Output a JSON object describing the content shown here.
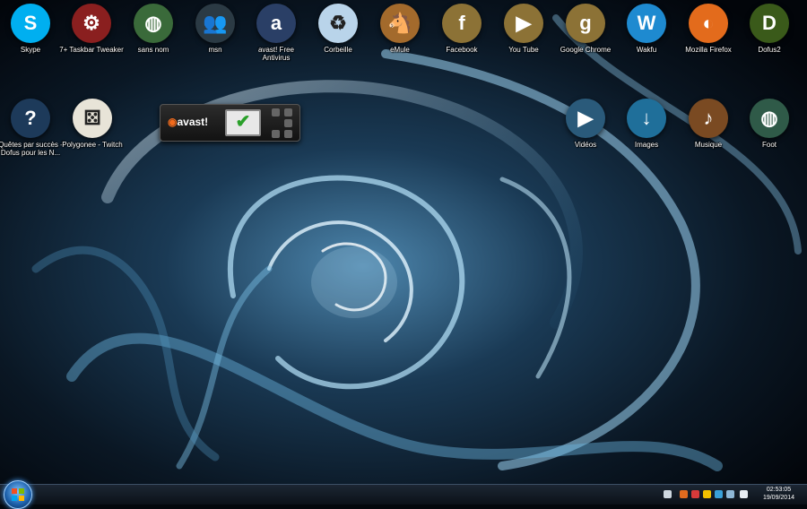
{
  "desktop": {
    "icons": [
      {
        "label": "Skype",
        "icon": "skype-icon",
        "color": "#00aff0"
      },
      {
        "label": "7+ Taskbar Tweaker",
        "icon": "gear-icon",
        "color": "#8a1f1f"
      },
      {
        "label": "sans nom",
        "icon": "globe-icon",
        "color": "#3a6a3a"
      },
      {
        "label": "msn",
        "icon": "people-icon",
        "color": "#2b3a44"
      },
      {
        "label": "avast! Free Antivirus",
        "icon": "avast-icon",
        "color": "#2a3f66"
      },
      {
        "label": "Corbeille",
        "icon": "recycle-bin-icon",
        "color": "#b9d4ea"
      },
      {
        "label": "eMule",
        "icon": "mule-icon",
        "color": "#a36a2c"
      },
      {
        "label": "Facebook",
        "icon": "facebook-shield-icon",
        "color": "#8c7236"
      },
      {
        "label": "You Tube",
        "icon": "youtube-shield-icon",
        "color": "#8c7236"
      },
      {
        "label": "Google Chrome",
        "icon": "google-shield-icon",
        "color": "#8c7236"
      },
      {
        "label": "Wakfu",
        "icon": "wakfu-icon",
        "color": "#1e8ad0"
      },
      {
        "label": "Mozilla Firefox",
        "icon": "firefox-icon",
        "color": "#e36b1c"
      },
      {
        "label": "Dofus2",
        "icon": "dofus-icon",
        "color": "#3a5a1a"
      },
      {
        "label": "Quêtes par succès - Dofus pour les N...",
        "icon": "help-sign-icon",
        "color": "#1d3a5a"
      },
      {
        "label": "Polygonee - Twitch",
        "icon": "dice-icon",
        "color": "#e8e4d8"
      },
      {
        "label": "Vidéos",
        "icon": "videos-folder-icon",
        "color": "#2a5a7a"
      },
      {
        "label": "Images",
        "icon": "images-folder-icon",
        "color": "#1f6f9a"
      },
      {
        "label": "Musique",
        "icon": "music-folder-icon",
        "color": "#7a4a22"
      },
      {
        "label": "Foot",
        "icon": "globe-icon",
        "color": "#2f5a48"
      }
    ]
  },
  "avast_gadget": {
    "logo_text": "avast!",
    "status_symbol": "✔"
  },
  "taskbar": {
    "time": "02:53:05",
    "date": "19/09/2014"
  }
}
